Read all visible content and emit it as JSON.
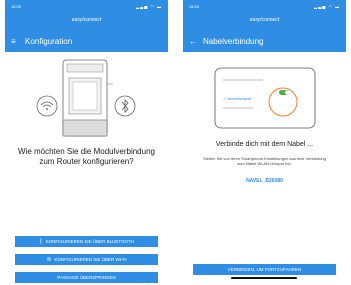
{
  "status": {
    "time": "16:25",
    "icons": "▂▃▅ ◠ ▬"
  },
  "left": {
    "logo": "easy/connect",
    "nav_title": "Konfiguration",
    "question": "Wie möchten Sie die Modulverbindung zum Router konfigurieren?",
    "btn_bluetooth": "Konfigurieren Sie über Bluetooth",
    "btn_wifi": "Konfigurieren Sie über Wi-Fi",
    "btn_skip": "Passage überspringen",
    "icons": [
      "menu-icon",
      "wifi-icon",
      "bluetooth-icon"
    ]
  },
  "right": {
    "logo": "easy/connect",
    "nav_title": "Nabelverbindung",
    "title": "Verbinde dich mit dem Nabel ...",
    "description": "Stellen Sie von Ihren Smartphone-Einstellungen aus eine Verbindung zum Nabel WLAN-Hotspot her.",
    "hotspot": "NAVEL_B26080",
    "illustration_label": "Nabelhotspot",
    "btn_done": "Verbinden, um fortzufahren",
    "icons": [
      "back-arrow-icon",
      "wifi-check-icon",
      "toggle-icon"
    ]
  },
  "colors": {
    "primary": "#2f8de4"
  }
}
